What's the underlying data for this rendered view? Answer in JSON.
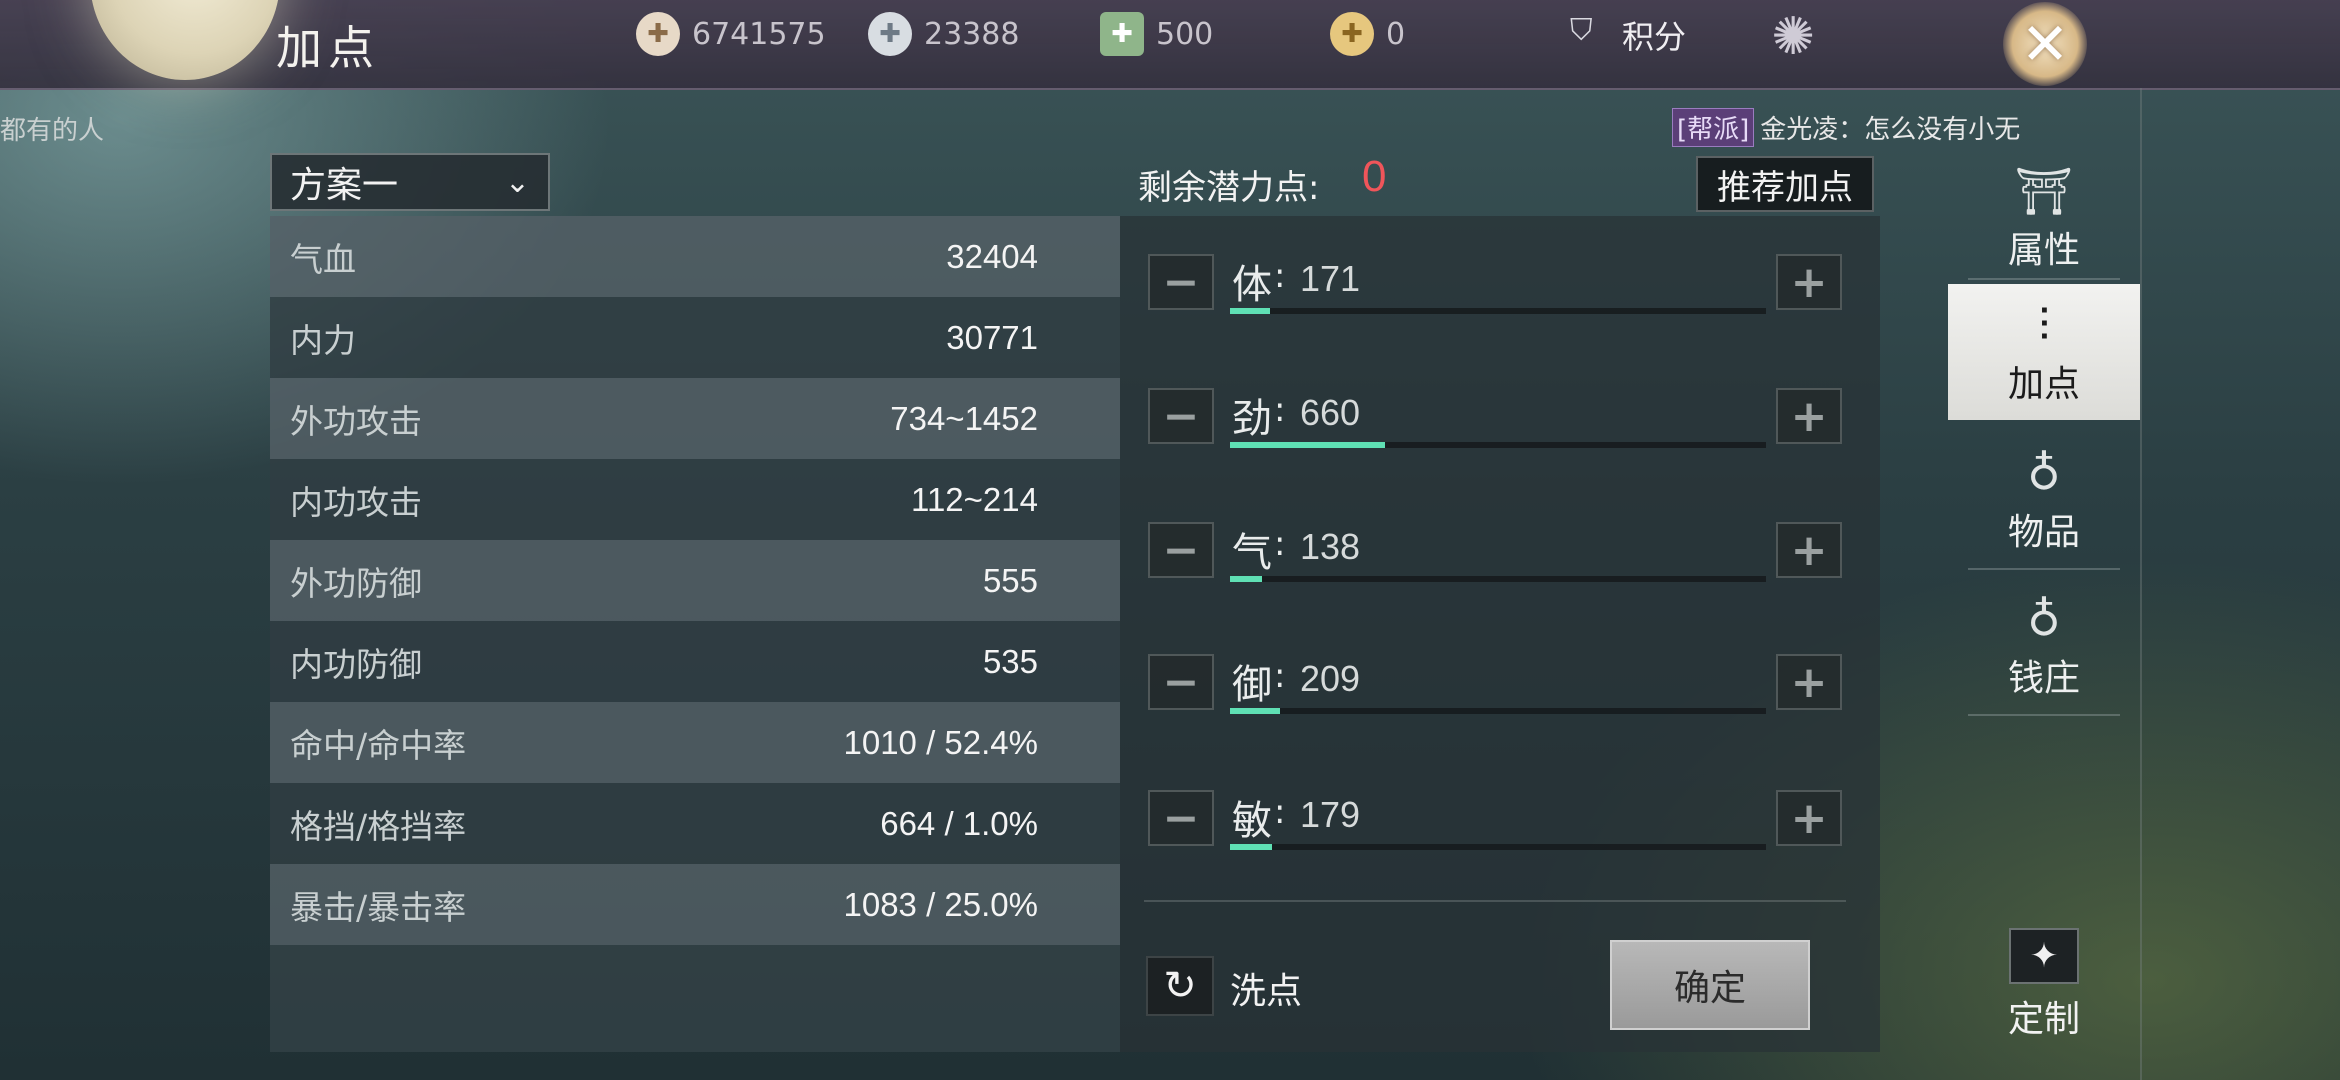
{
  "header": {
    "title": "加点",
    "resources": [
      {
        "icon": "coin-icon",
        "value": "6741575"
      },
      {
        "icon": "silver-ingot-icon",
        "value": "23388"
      },
      {
        "icon": "jade-note-icon",
        "value": "500"
      },
      {
        "icon": "gold-ingot-icon",
        "value": "0"
      }
    ],
    "score_label": "积分"
  },
  "chat": {
    "left_fragment": "都有的人",
    "tag": "[帮派]",
    "message": "金光凌：怎么没有小无"
  },
  "plan": {
    "selected": "方案一"
  },
  "stats": [
    {
      "name": "气血",
      "value": "32404"
    },
    {
      "name": "内力",
      "value": "30771"
    },
    {
      "name": "外功攻击",
      "value": "734~1452"
    },
    {
      "name": "内功攻击",
      "value": "112~214"
    },
    {
      "name": "外功防御",
      "value": "555"
    },
    {
      "name": "内功防御",
      "value": "535"
    },
    {
      "name": "命中/命中率",
      "value": "1010 / 52.4%"
    },
    {
      "name": "格挡/格挡率",
      "value": "664 / 1.0%"
    },
    {
      "name": "暴击/暴击率",
      "value": "1083 / 25.0%"
    }
  ],
  "potential": {
    "remaining_label": "剩余潜力点:",
    "remaining_value": "0",
    "recommend_label": "推荐加点"
  },
  "attributes": [
    {
      "name": "体",
      "value": "171",
      "level": 0.075
    },
    {
      "name": "劲",
      "value": "660",
      "level": 0.29
    },
    {
      "name": "气",
      "value": "138",
      "level": 0.06
    },
    {
      "name": "御",
      "value": "209",
      "level": 0.093
    },
    {
      "name": "敏",
      "value": "179",
      "level": 0.079
    }
  ],
  "actions": {
    "reset_label": "洗点",
    "confirm_label": "确定"
  },
  "sidenav": [
    {
      "label": "属性",
      "icon": "hat-icon"
    },
    {
      "label": "加点",
      "icon": "sliders-icon",
      "active": true
    },
    {
      "label": "物品",
      "icon": "bag-icon"
    },
    {
      "label": "钱庄",
      "icon": "money-bag-icon"
    }
  ],
  "custom_label": "定制",
  "colors": {
    "accent": "#5fe0b4",
    "remaining": "#f0555a",
    "active_tab": "#e8e8e4"
  }
}
